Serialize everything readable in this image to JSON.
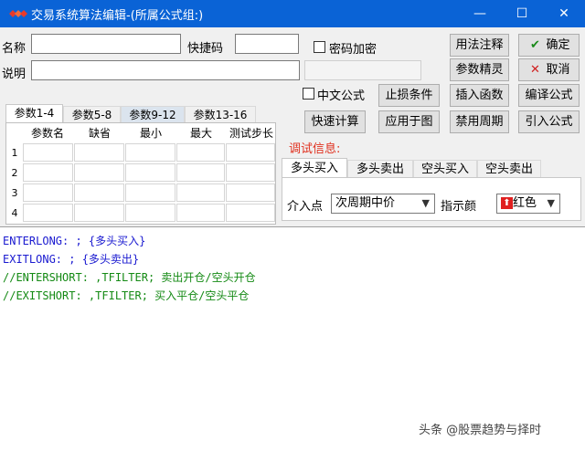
{
  "window": {
    "title": "交易系统算法编辑-(所属公式组:)",
    "minimize": "—",
    "maximize": "☐",
    "close": "✕",
    "icon": "app-logo-icon",
    "icon_color": "#e83a2a"
  },
  "form": {
    "name_label": "名称",
    "name_value": "",
    "shortcut_label": "快捷码",
    "shortcut_value": "",
    "password_label": "密码加密",
    "desc_label": "说明",
    "desc_value": "",
    "chinese_formula_label": "中文公式"
  },
  "buttons": {
    "usage_notes": "用法注释",
    "confirm": "确定",
    "param_wizard": "参数精灵",
    "cancel": "取消",
    "stop_loss": "止损条件",
    "insert_function": "插入函数",
    "compile": "编译公式",
    "quick_calc": "快速计算",
    "apply_to_chart": "应用于图",
    "disable_period": "禁用周期",
    "import_formula": "引入公式"
  },
  "param_tabs": [
    "参数1-4",
    "参数5-8",
    "参数9-12",
    "参数13-16"
  ],
  "param_columns": [
    "参数名",
    "缺省",
    "最小",
    "最大",
    "测试步长"
  ],
  "param_rows": [
    "1",
    "2",
    "3",
    "4"
  ],
  "debug": {
    "label": "调试信息:",
    "label_color": "#e0301e"
  },
  "signal_tabs": [
    "多头买入",
    "多头卖出",
    "空头买入",
    "空头卖出"
  ],
  "signal_panel": {
    "entry_label": "介入点",
    "entry_value": "次周期中价",
    "indicator_color_label": "指示颜",
    "indicator_color_value": "红色",
    "indicator_color": "#e02020"
  },
  "code_lines": [
    {
      "text": "ENTERLONG: ; {多头买入}",
      "color": "#1a1ad0"
    },
    {
      "text": "EXITLONG: ; {多头卖出}",
      "color": "#1a1ad0"
    },
    {
      "text": "//ENTERSHORT: ,TFILTER; 卖出开仓/空头开仓",
      "color": "#148a14"
    },
    {
      "text": "//EXITSHORT: ,TFILTER; 买入平仓/空头平仓",
      "color": "#148a14"
    }
  ],
  "watermark": "头条 @股票趋势与择时"
}
